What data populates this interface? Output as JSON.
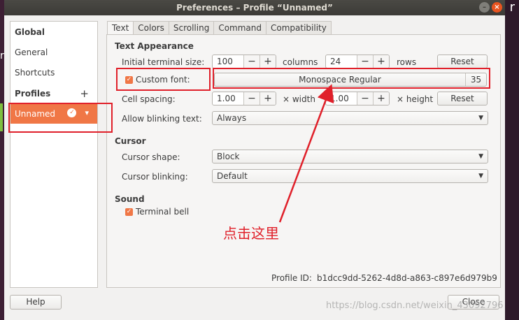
{
  "window": {
    "title": "Preferences – Profile “Unnamed”",
    "minimize_glyph": "–",
    "close_glyph": "×"
  },
  "desktop": {
    "left_text": "r",
    "right_text": "r"
  },
  "sidebar": {
    "global_label": "Global",
    "general_label": "General",
    "shortcuts_label": "Shortcuts",
    "profiles_label": "Profiles",
    "add_profile_glyph": "+",
    "selected_profile": "Unnamed",
    "profile_menu_glyph": "▾",
    "profile_default_glyph": "✓"
  },
  "tabs": [
    {
      "label": "Text",
      "active": true
    },
    {
      "label": "Colors"
    },
    {
      "label": "Scrolling"
    },
    {
      "label": "Command"
    },
    {
      "label": "Compatibility"
    }
  ],
  "text_appearance": {
    "section_title": "Text Appearance",
    "terminal_size_label": "Initial terminal size:",
    "columns_value": "100",
    "columns_label": "columns",
    "rows_value": "24",
    "rows_label": "rows",
    "reset_label": "Reset",
    "minus_glyph": "−",
    "plus_glyph": "+",
    "custom_font_label": "Custom font:",
    "custom_font_checked": true,
    "font_name": "Monospace Regular",
    "font_size": "35",
    "cell_spacing_label": "Cell spacing:",
    "width_value": "1.00",
    "width_label": "× width",
    "height_value": "1.00",
    "height_label": "× height",
    "blinking_label": "Allow blinking text:",
    "blinking_value": "Always"
  },
  "cursor": {
    "section_title": "Cursor",
    "shape_label": "Cursor shape:",
    "shape_value": "Block",
    "blinking_label": "Cursor blinking:",
    "blinking_value": "Default"
  },
  "sound": {
    "section_title": "Sound",
    "terminal_bell_label": "Terminal bell",
    "terminal_bell_checked": true
  },
  "profile_id": {
    "label": "Profile ID:",
    "value": "b1dcc9dd-5262-4d8d-a863-c897e6d979b9"
  },
  "footer": {
    "help_label": "Help",
    "close_label": "Close"
  },
  "annotation": {
    "text": "点击这里",
    "color": "#e0202a"
  },
  "watermark": "https://blog.csdn.net/weixin_43092796",
  "colors": {
    "accent": "#f07746",
    "titlebar": "#3c3b37",
    "annotation": "#e0202a"
  }
}
